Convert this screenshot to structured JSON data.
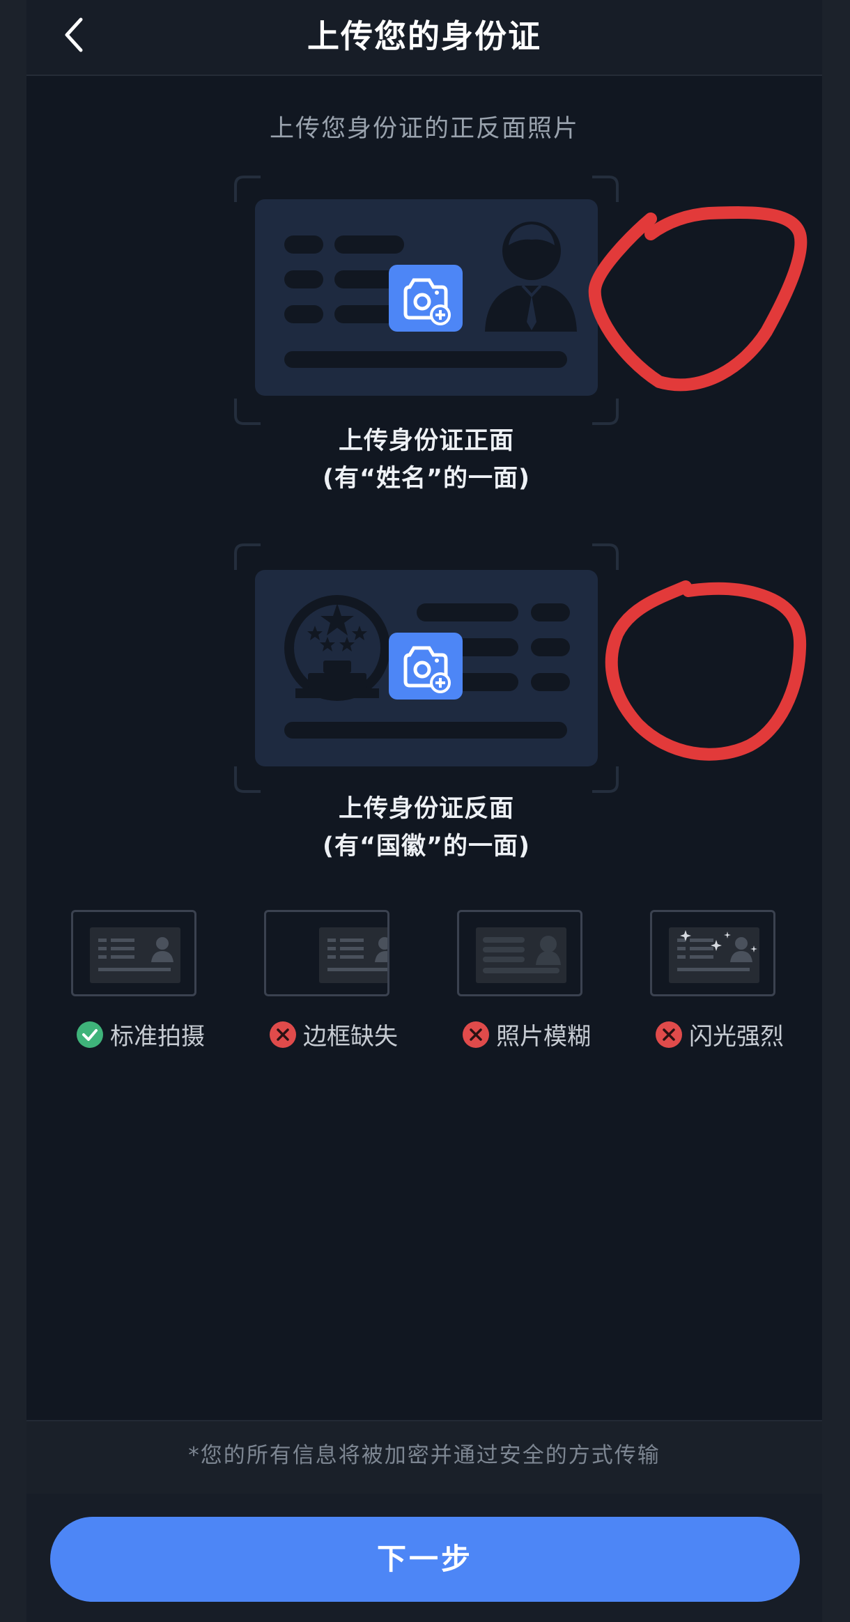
{
  "header": {
    "title": "上传您的身份证",
    "back_icon": "chevron-left-icon"
  },
  "subtitle": "上传您身份证的正反面照片",
  "front_card": {
    "line1": "上传身份证正面",
    "line2": "(有“姓名”的一面)",
    "icon": "camera-add-icon"
  },
  "back_card": {
    "line1": "上传身份证反面",
    "line2": "(有“国徽”的一面)",
    "icon": "camera-add-icon"
  },
  "examples": [
    {
      "label": "标准拍摄",
      "status": "ok",
      "icon": "check-circle-icon"
    },
    {
      "label": "边框缺失",
      "status": "bad",
      "icon": "x-circle-icon"
    },
    {
      "label": "照片模糊",
      "status": "bad",
      "icon": "x-circle-icon"
    },
    {
      "label": "闪光强烈",
      "status": "bad",
      "icon": "x-circle-icon"
    }
  ],
  "footer_note": "*您的所有信息将被加密并通过安全的方式传输",
  "next_button": "下一步",
  "colors": {
    "background": "#111721",
    "card": "#1e2a40",
    "accent": "#4d86f6",
    "ok": "#3fb37a",
    "bad": "#e04b4b",
    "annotation": "#e23a3a"
  }
}
